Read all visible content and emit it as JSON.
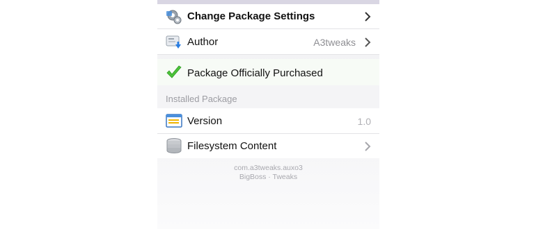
{
  "rows": {
    "settings": {
      "label": "Change Package Settings",
      "icon": "gears-icon"
    },
    "author": {
      "label": "Author",
      "value": "A3tweaks",
      "icon": "contact-card-icon"
    },
    "purchased": {
      "label": "Package Officially Purchased",
      "icon": "checkmark-icon"
    }
  },
  "installed": {
    "header": "Installed Package",
    "version": {
      "label": "Version",
      "value": "1.0",
      "icon": "window-icon"
    },
    "filesystem": {
      "label": "Filesystem Content",
      "icon": "database-icon"
    }
  },
  "footer": {
    "package_id": "com.a3tweaks.auxo3",
    "source": "BigBoss · Tweaks"
  },
  "colors": {
    "check_green": "#4cc43a",
    "chevron": "#8a8a90",
    "accent_blue": "#2a7de1"
  }
}
